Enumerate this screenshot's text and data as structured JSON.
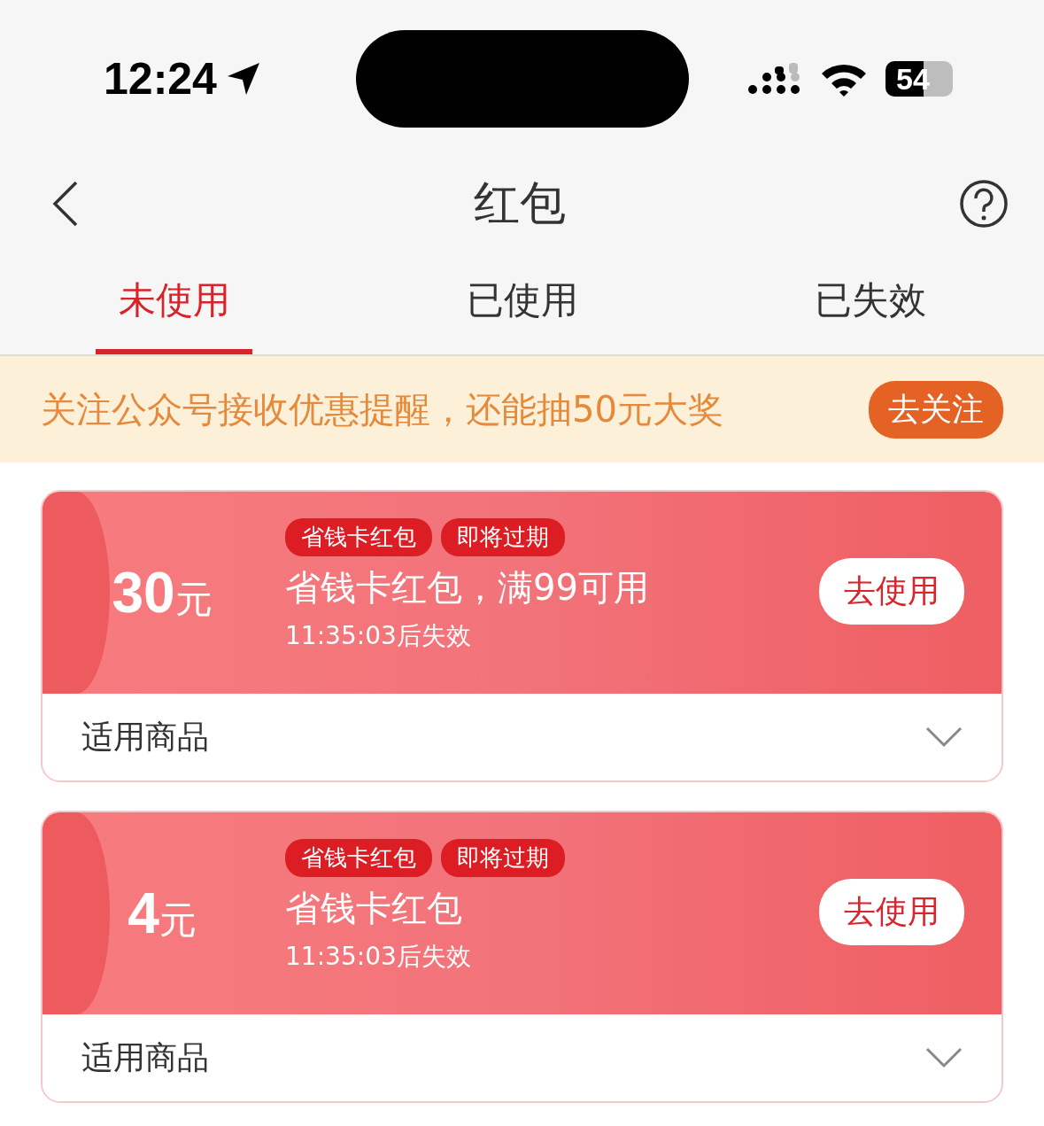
{
  "status_bar": {
    "time": "12:24",
    "battery": "54"
  },
  "nav": {
    "title": "红包"
  },
  "tabs": [
    {
      "label": "未使用",
      "selected": true
    },
    {
      "label": "已使用",
      "selected": false
    },
    {
      "label": "已失效",
      "selected": false
    }
  ],
  "banner": {
    "text": "关注公众号接收优惠提醒，还能抽50元大奖",
    "button": "去关注"
  },
  "coupons": [
    {
      "amount": "30",
      "unit": "元",
      "tags": [
        "省钱卡红包",
        "即将过期"
      ],
      "title": "省钱卡红包，满99可用",
      "expiry": "11:35:03后失效",
      "button": "去使用",
      "footer": "适用商品"
    },
    {
      "amount": "4",
      "unit": "元",
      "tags": [
        "省钱卡红包",
        "即将过期"
      ],
      "title": "省钱卡红包",
      "expiry": "11:35:03后失效",
      "button": "去使用",
      "footer": "适用商品"
    }
  ]
}
